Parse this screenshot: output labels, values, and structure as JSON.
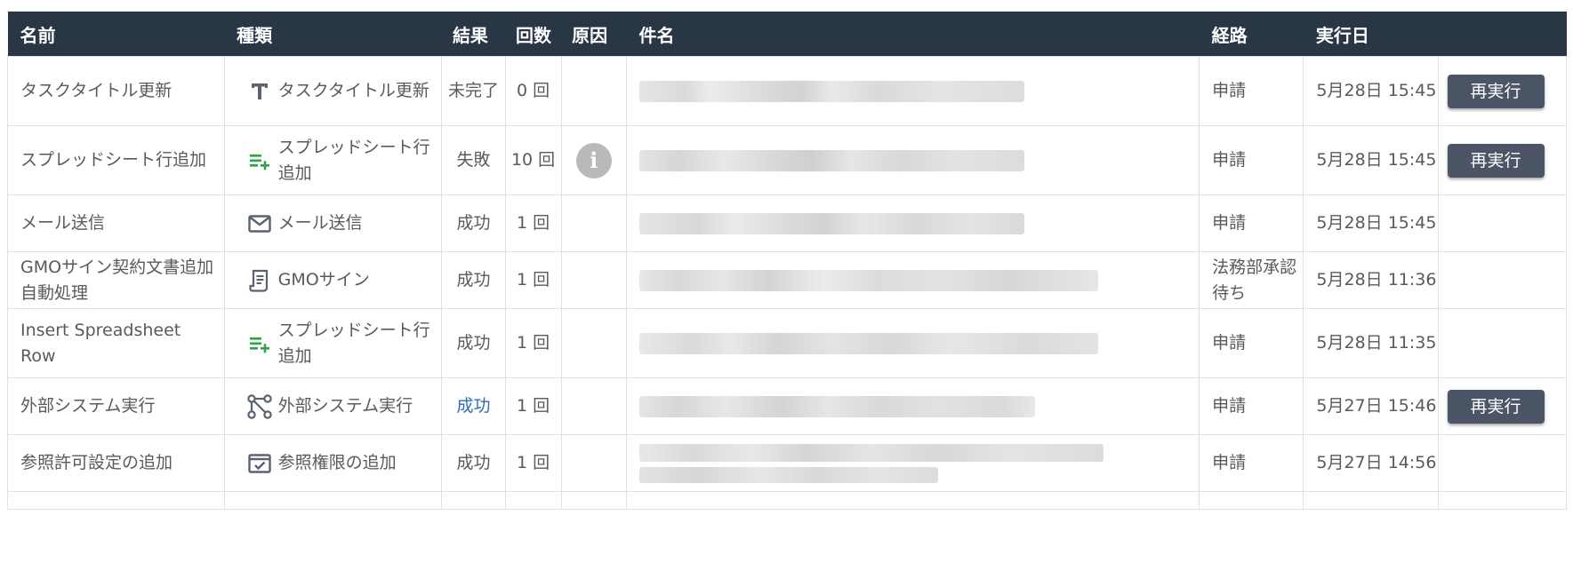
{
  "table": {
    "headers": {
      "name": "名前",
      "kind": "種類",
      "result": "結果",
      "count": "回数",
      "cause": "原因",
      "subject": "件名",
      "route": "経路",
      "date": "実行日"
    },
    "rerun_label": "再実行",
    "rows": [
      {
        "name": "タスクタイトル更新",
        "kind_icon": "text-icon",
        "kind": "タスクタイトル更新",
        "result": "未完了",
        "count": "0 回",
        "route": "申請",
        "date": "5月28日 15:45"
      },
      {
        "name": "スプレッドシート行追加",
        "kind_icon": "add-row-icon",
        "kind": "スプレッドシート行追加",
        "result": "失敗",
        "count": "10 回",
        "route": "申請",
        "date": "5月28日 15:45"
      },
      {
        "name": "メール送信",
        "kind_icon": "mail-icon",
        "kind": "メール送信",
        "result": "成功",
        "count": "1 回",
        "route": "申請",
        "date": "5月28日 15:45"
      },
      {
        "name": "GMOサイン契約文書追加自動処理",
        "kind_icon": "document-icon",
        "kind": "GMOサイン",
        "result": "成功",
        "count": "1 回",
        "route": "法務部承認待ち",
        "date": "5月28日 11:36"
      },
      {
        "name": "Insert Spreadsheet Row",
        "kind_icon": "add-row-icon",
        "kind": "スプレッドシート行追加",
        "result": "成功",
        "count": "1 回",
        "route": "申請",
        "date": "5月28日 11:35"
      },
      {
        "name": "外部システム実行",
        "kind_icon": "connection-icon",
        "kind": "外部システム実行",
        "result": "成功",
        "count": "1 回",
        "route": "申請",
        "date": "5月27日 15:46"
      },
      {
        "name": "参照許可設定の追加",
        "kind_icon": "permission-icon",
        "kind": "参照権限の追加",
        "result": "成功",
        "count": "1 回",
        "route": "申請",
        "date": "5月27日 14:56"
      }
    ]
  },
  "colors": {
    "header_bg": "#283646",
    "button_bg": "#4c5566",
    "icon_green": "#2aa34a",
    "link_blue": "#2d6db4"
  }
}
